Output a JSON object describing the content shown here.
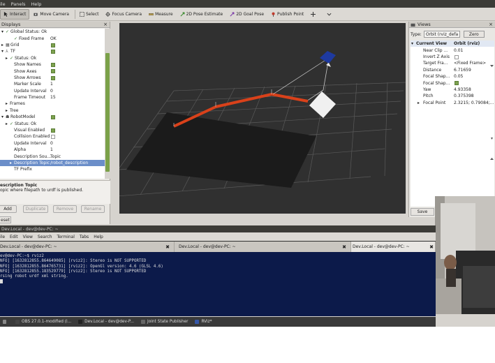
{
  "menubar": {
    "items": [
      "ile",
      "Panels",
      "Help"
    ]
  },
  "toolbar": {
    "tools": [
      {
        "label": "Interact",
        "icon": "cursor-icon",
        "active": true
      },
      {
        "label": "Move Camera",
        "icon": "move-camera-icon"
      },
      {
        "label": "Select",
        "icon": "select-icon"
      },
      {
        "label": "Focus Camera",
        "icon": "focus-camera-icon"
      },
      {
        "label": "Measure",
        "icon": "measure-icon"
      },
      {
        "label": "2D Pose Estimate",
        "icon": "pose-estimate-icon"
      },
      {
        "label": "2D Goal Pose",
        "icon": "goal-pose-icon"
      },
      {
        "label": "Publish Point",
        "icon": "publish-point-icon"
      }
    ],
    "extra_icons": [
      "crosshair-icon",
      "dropdown-icon"
    ]
  },
  "displays": {
    "title": "Displays",
    "rows": [
      {
        "key": "Global Status: Ok",
        "value": "",
        "indent": 0,
        "icon": "check-icon",
        "expander": "▾"
      },
      {
        "key": "Fixed Frame",
        "value": "OK",
        "indent": 2,
        "icon": "check-icon"
      },
      {
        "key": "Grid",
        "value": "",
        "indent": 0,
        "icon": "grid-icon",
        "expander": "▸",
        "checkbox": true
      },
      {
        "key": "TF",
        "value": "",
        "indent": 0,
        "icon": "tf-icon",
        "expander": "▾",
        "checkbox": true
      },
      {
        "key": "Status: Ok",
        "value": "",
        "indent": 1,
        "icon": "check-icon",
        "expander": "▸"
      },
      {
        "key": "Show Names",
        "value": "",
        "indent": 2,
        "checkbox": true
      },
      {
        "key": "Show Axes",
        "value": "",
        "indent": 2,
        "checkbox": true
      },
      {
        "key": "Show Arrows",
        "value": "",
        "indent": 2,
        "checkbox": true
      },
      {
        "key": "Marker Scale",
        "value": "1",
        "indent": 2
      },
      {
        "key": "Update Interval",
        "value": "0",
        "indent": 2
      },
      {
        "key": "Frame Timeout",
        "value": "15",
        "indent": 2
      },
      {
        "key": "Frames",
        "value": "",
        "indent": 1,
        "expander": "▸"
      },
      {
        "key": "Tree",
        "value": "",
        "indent": 1,
        "expander": "▸"
      },
      {
        "key": "RobotModel",
        "value": "",
        "indent": 0,
        "icon": "robot-icon",
        "expander": "▾",
        "checkbox": true
      },
      {
        "key": "Status: Ok",
        "value": "",
        "indent": 1,
        "icon": "check-icon",
        "expander": "▸"
      },
      {
        "key": "Visual Enabled",
        "value": "",
        "indent": 2,
        "checkbox": true
      },
      {
        "key": "Collision Enabled",
        "value": "",
        "indent": 2,
        "checkbox": false
      },
      {
        "key": "Update Interval",
        "value": "0",
        "indent": 2
      },
      {
        "key": "Alpha",
        "value": "1",
        "indent": 2
      },
      {
        "key": "Description Sou...",
        "value": "Topic",
        "indent": 2
      },
      {
        "key": "Description Topic",
        "value": "/robot_description",
        "indent": 2,
        "expander": "▸",
        "selected": true
      },
      {
        "key": "TF Prefix",
        "value": "",
        "indent": 2
      }
    ],
    "description_title": "escription Topic",
    "description_text": "opic where filepath to urdf is published.",
    "buttons": [
      "Add",
      "Duplicate",
      "Remove",
      "Rename"
    ],
    "reset": "eset"
  },
  "views": {
    "title": "Views",
    "type_label": "Type:",
    "type_value": "Orbit (rviz_defa",
    "zero_label": "Zero",
    "rows": [
      {
        "key": "Current View",
        "value": "Orbit (rviz)",
        "head": true
      },
      {
        "key": "Near Clip ...",
        "value": "0.01"
      },
      {
        "key": "Invert Z Axis",
        "value": "",
        "checkbox": false
      },
      {
        "key": "Target Fra...",
        "value": "<Fixed Frame>"
      },
      {
        "key": "Distance",
        "value": "6.71659"
      },
      {
        "key": "Focal Shap...",
        "value": "0.05"
      },
      {
        "key": "Focal Shap...",
        "value": "",
        "checkbox": true
      },
      {
        "key": "Yaw",
        "value": "4.93358"
      },
      {
        "key": "Pitch",
        "value": "0.375398"
      },
      {
        "key": "Focal Point",
        "value": "2.3215; 0.79084;...",
        "expander": "▸"
      }
    ],
    "save_label": "Save"
  },
  "terminal": {
    "window_title": "Dev.Local - dev@dev-PC: ~",
    "menu": [
      "ile",
      "Edit",
      "View",
      "Search",
      "Terminal",
      "Tabs",
      "Help"
    ],
    "tabs": [
      {
        "label": "Dev.Local - dev@dev-PC: ~"
      },
      {
        "label": "Dev.Local - dev@dev-PC: ~"
      },
      {
        "label": "Dev.Local - dev@dev-PC: ~",
        "active": true
      }
    ],
    "lines": [
      "ev@dev-PC:~$ rviz2",
      "NFO] [1632812855.864649085] [rviz2]: Stereo is NOT SUPPORTED",
      "NFO] [1632812855.864765731] [rviz2]: OpenGl version: 4.6 (GLSL 4.6)",
      "NFO] [1632812855.183529779] [rviz2]: Stereo is NOT SUPPORTED",
      "rsing robot urdf xml string."
    ]
  },
  "taskbar": {
    "items": [
      {
        "label": "",
        "icon": "app-icon"
      },
      {
        "label": "OBS 27.0.1-modified (l...",
        "icon": "obs-icon"
      },
      {
        "label": "Dev.Local - dev@dev-P...",
        "icon": "terminal-icon"
      },
      {
        "label": "Joint State Publisher",
        "icon": "window-icon"
      },
      {
        "label": "RViz*",
        "icon": "rviz-icon"
      }
    ]
  },
  "colors": {
    "viewport_bg": "#303030",
    "link_red": "#e0461c",
    "accent_green": "#7da24f",
    "terminal_bg": "#0c1a4a"
  }
}
